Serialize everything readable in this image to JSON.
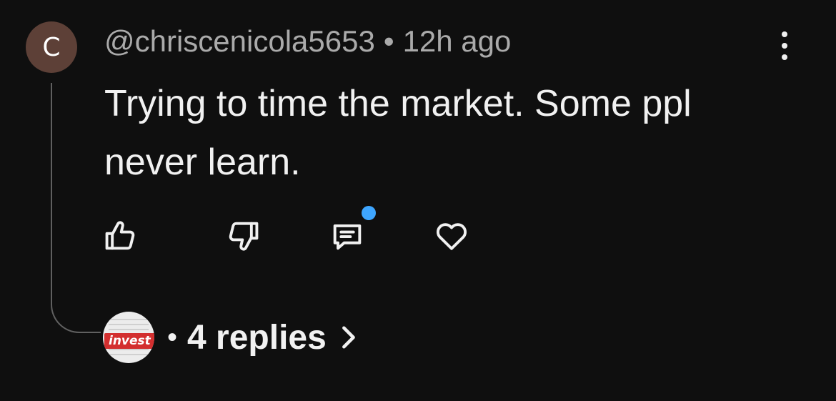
{
  "comment": {
    "avatar_letter": "C",
    "avatar_color": "#5d4037",
    "username": "@chriscenicola5653",
    "separator": "•",
    "time": "12h ago",
    "text": "Trying to time the market. Some ppl never learn."
  },
  "actions": {
    "like_icon": "thumbs-up-icon",
    "dislike_icon": "thumbs-down-icon",
    "reply_icon": "comment-icon",
    "heart_icon": "heart-icon",
    "notification_dot_color": "#3ea6ff"
  },
  "replies": {
    "avatar_text": "invest",
    "separator": "•",
    "label": "4 replies"
  }
}
